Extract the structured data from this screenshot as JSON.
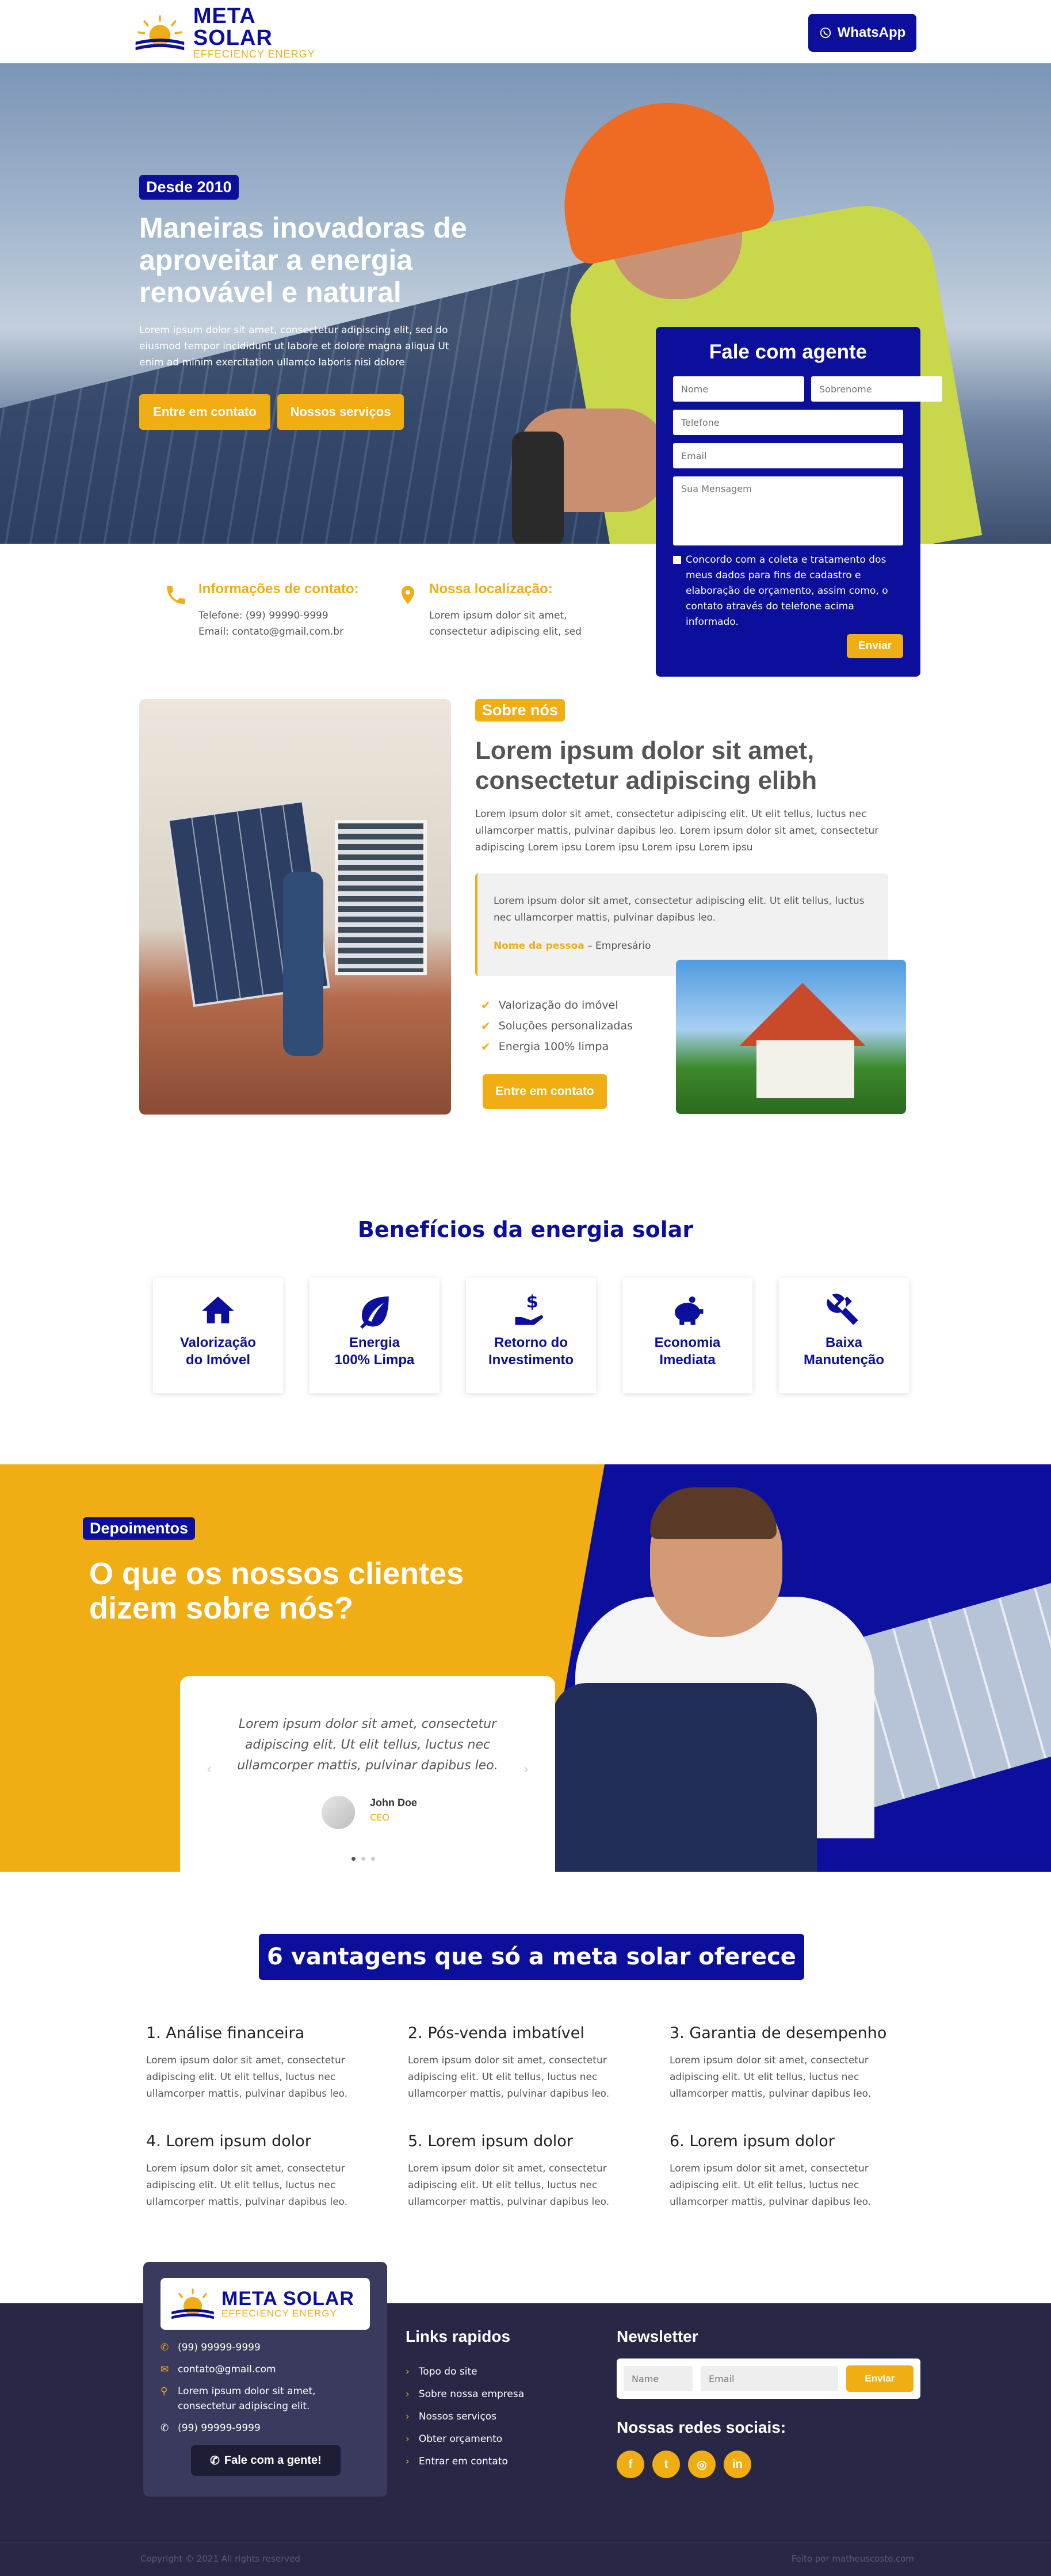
{
  "brand": {
    "name": "META SOLAR",
    "tagline": "EFFECIENCY ENERGY",
    "colors": {
      "primary": "#0b0f9c",
      "accent": "#f0ad14",
      "footer": "#282846"
    }
  },
  "header": {
    "whatsapp_label": "WhatsApp"
  },
  "hero": {
    "badge": "Desde 2010",
    "title": "Maneiras inovadoras de aproveitar a energia renovável e natural",
    "text": "Lorem ipsum dolor sit amet, consectetur adipiscing elit, sed do eiusmod tempor incididunt ut labore et dolore magna aliqua Ut enim ad minim exercitation ullamco laboris nisi dolore",
    "btn_contact": "Entre em contato",
    "btn_services": "Nossos serviços"
  },
  "form": {
    "title": "Fale com agente",
    "placeholders": {
      "name": "Nome",
      "surname": "Sobrenome",
      "phone": "Telefone",
      "email": "Email",
      "message": "Sua Mensagem"
    },
    "consent": "Concordo com a coleta e tratamento dos meus dados para fins de cadastro e elaboração de orçamento, assim como, o contato através do telefone acima informado.",
    "submit": "Enviar"
  },
  "contact": {
    "info_title": "Informações de contato:",
    "phone": "Telefone: (99) 99990-9999",
    "email": "Email: contato@gmail.com.br",
    "location_title": "Nossa localização:",
    "address": "Lorem ipsum dolor sit amet, consectetur adipiscing elit, sed"
  },
  "about": {
    "badge": "Sobre nós",
    "title": "Lorem ipsum dolor sit amet, consectetur adipiscing elibh",
    "text": "Lorem ipsum dolor sit amet, consectetur adipiscing elit. Ut elit tellus, luctus nec ullamcorper mattis, pulvinar dapibus leo. Lorem ipsum dolor sit amet, consectetur adipiscing Lorem ipsu Lorem ipsu Lorem ipsu Lorem ipsu",
    "quote": "Lorem ipsum dolor sit amet, consectetur adipiscing elit. Ut elit tellus, luctus nec ullamcorper mattis, pulvinar dapibus leo.",
    "quote_name": "Nome da pessoa",
    "quote_role": " – Empresário",
    "checks": [
      "Valorização do imóvel",
      "Soluções personalizadas",
      "Energia 100% limpa"
    ],
    "btn": "Entre em contato"
  },
  "benefits": {
    "title": "Benefícios da energia solar",
    "cards": [
      {
        "icon": "home-icon",
        "line1": "Valorização",
        "line2": "do Imóvel"
      },
      {
        "icon": "leaf-icon",
        "line1": "Energia",
        "line2": "100% Limpa"
      },
      {
        "icon": "hand-dollar-icon",
        "line1": "Retorno do",
        "line2": "Investimento"
      },
      {
        "icon": "piggy-bank-icon",
        "line1": "Economia",
        "line2": "Imediata"
      },
      {
        "icon": "tools-icon",
        "line1": "Baixa",
        "line2": "Manutenção"
      }
    ]
  },
  "testimonials": {
    "badge": "Depoimentos",
    "title": "O que os nossos clientes dizem sobre nós?",
    "quote": "Lorem ipsum dolor sit amet, consectetur adipiscing elit. Ut elit tellus, luctus nec ullamcorper mattis, pulvinar dapibus leo.",
    "name": "John Doe",
    "role": "CEO"
  },
  "advantages": {
    "title": "6 vantagens que só a meta solar oferece",
    "items": [
      {
        "title": "1. Análise financeira",
        "text": "Lorem ipsum dolor sit amet, consectetur adipiscing elit. Ut elit tellus, luctus nec ullamcorper mattis, pulvinar dapibus leo."
      },
      {
        "title": "2. Pós-venda imbatível",
        "text": "Lorem ipsum dolor sit amet, consectetur adipiscing elit. Ut elit tellus, luctus nec ullamcorper mattis, pulvinar dapibus leo."
      },
      {
        "title": "3. Garantia de desempenho",
        "text": "Lorem ipsum dolor sit amet, consectetur adipiscing elit. Ut elit tellus, luctus nec ullamcorper mattis, pulvinar dapibus leo."
      },
      {
        "title": "4. Lorem ipsum dolor",
        "text": "Lorem ipsum dolor sit amet, consectetur adipiscing elit. Ut elit tellus, luctus nec ullamcorper mattis, pulvinar dapibus leo."
      },
      {
        "title": "5. Lorem ipsum dolor",
        "text": "Lorem ipsum dolor sit amet, consectetur adipiscing elit. Ut elit tellus, luctus nec ullamcorper mattis, pulvinar dapibus leo."
      },
      {
        "title": "6. Lorem ipsum dolor",
        "text": "Lorem ipsum dolor sit amet, consectetur adipiscing elit. Ut elit tellus, luctus nec ullamcorper mattis, pulvinar dapibus leo."
      }
    ]
  },
  "footer": {
    "phone1": "(99) 99999-9999",
    "email": "contato@gmail.com",
    "address": "Lorem ipsum dolor sit amet, consectetur adipiscing elit.",
    "phone2": "(99) 99999-9999",
    "cta": "Fale com a gente!",
    "links_title": "Links rapidos",
    "links": [
      "Topo do site",
      "Sobre nossa empresa",
      "Nossos serviços",
      "Obter orçamento",
      "Entrar em contato"
    ],
    "newsletter_title": "Newsletter",
    "nl_name": "Name",
    "nl_email": "Email",
    "nl_btn": "Enviar",
    "social_title": "Nossas redes sociais:",
    "socials": [
      "facebook-icon",
      "twitter-icon",
      "instagram-icon",
      "linkedin-icon"
    ],
    "copyright": "Copyright © 2021 All rights reserved",
    "credit": "Feito por matheuscosto.com"
  }
}
